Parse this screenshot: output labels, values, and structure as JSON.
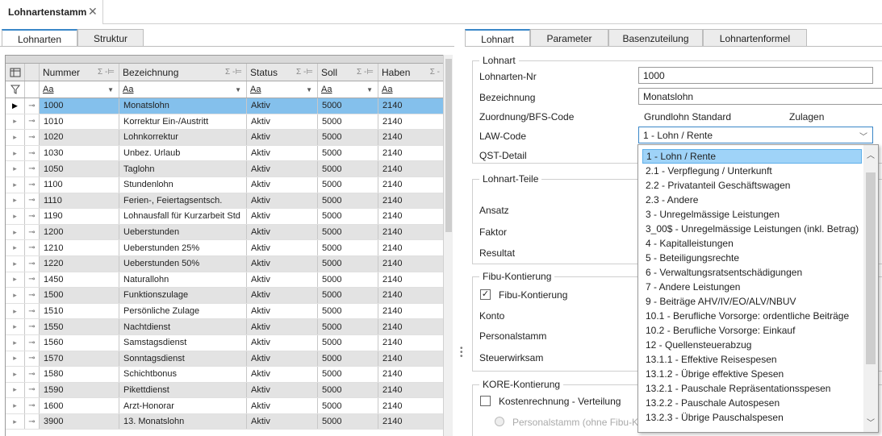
{
  "doc_tab": {
    "title": "Lohnartenstamm",
    "close": "✕"
  },
  "left_tabs": [
    {
      "label": "Lohnarten",
      "active": true
    },
    {
      "label": "Struktur",
      "active": false
    }
  ],
  "right_tabs": [
    {
      "label": "Lohnart",
      "active": true
    },
    {
      "label": "Parameter",
      "active": false
    },
    {
      "label": "Basenzuteilung",
      "active": false
    },
    {
      "label": "Lohnartenformel",
      "active": false
    }
  ],
  "grid": {
    "columns": [
      "Nummer",
      "Bezeichnung",
      "Status",
      "Soll",
      "Haben"
    ],
    "filter_text": "Aa",
    "selected_index": 0,
    "rows": [
      [
        "1000",
        "Monatslohn",
        "Aktiv",
        "5000",
        "2140"
      ],
      [
        "1010",
        "Korrektur Ein-/Austritt",
        "Aktiv",
        "5000",
        "2140"
      ],
      [
        "1020",
        "Lohnkorrektur",
        "Aktiv",
        "5000",
        "2140"
      ],
      [
        "1030",
        "Unbez. Urlaub",
        "Aktiv",
        "5000",
        "2140"
      ],
      [
        "1050",
        "Taglohn",
        "Aktiv",
        "5000",
        "2140"
      ],
      [
        "1100",
        "Stundenlohn",
        "Aktiv",
        "5000",
        "2140"
      ],
      [
        "1110",
        "Ferien-, Feiertagsentsch.",
        "Aktiv",
        "5000",
        "2140"
      ],
      [
        "1190",
        "Lohnausfall für Kurzarbeit Std",
        "Aktiv",
        "5000",
        "2140"
      ],
      [
        "1200",
        "Ueberstunden",
        "Aktiv",
        "5000",
        "2140"
      ],
      [
        "1210",
        "Ueberstunden 25%",
        "Aktiv",
        "5000",
        "2140"
      ],
      [
        "1220",
        "Ueberstunden 50%",
        "Aktiv",
        "5000",
        "2140"
      ],
      [
        "1450",
        "Naturallohn",
        "Aktiv",
        "5000",
        "2140"
      ],
      [
        "1500",
        "Funktionszulage",
        "Aktiv",
        "5000",
        "2140"
      ],
      [
        "1510",
        "Persönliche Zulage",
        "Aktiv",
        "5000",
        "2140"
      ],
      [
        "1550",
        "Nachtdienst",
        "Aktiv",
        "5000",
        "2140"
      ],
      [
        "1560",
        "Samstagsdienst",
        "Aktiv",
        "5000",
        "2140"
      ],
      [
        "1570",
        "Sonntagsdienst",
        "Aktiv",
        "5000",
        "2140"
      ],
      [
        "1580",
        "Schichtbonus",
        "Aktiv",
        "5000",
        "2140"
      ],
      [
        "1590",
        "Pikettdienst",
        "Aktiv",
        "5000",
        "2140"
      ],
      [
        "1600",
        "Arzt-Honorar",
        "Aktiv",
        "5000",
        "2140"
      ],
      [
        "3900",
        "13. Monatslohn",
        "Aktiv",
        "5000",
        "2140"
      ]
    ]
  },
  "form": {
    "group_lohnart": "Lohnart",
    "nr_label": "Lohnarten-Nr",
    "nr_value": "1000",
    "bez_label": "Bezeichnung",
    "bez_value": "Monatslohn",
    "zuord_label": "Zuordnung/BFS-Code",
    "zuord_value": "Grundlohn Standard",
    "zuord_value2": "Zulagen",
    "law_label": "LAW-Code",
    "law_value": "1 - Lohn / Rente",
    "qst_label": "QST-Detail",
    "group_teile": "Lohnart-Teile",
    "ansatz_label": "Ansatz",
    "faktor_label": "Faktor",
    "resultat_label": "Resultat",
    "group_fibu": "Fibu-Kontierung",
    "fibu_cb_label": "Fibu-Kontierung",
    "fibu_checked": true,
    "konto_label": "Konto",
    "personal_label": "Personalstamm",
    "steuer_label": "Steuerwirksam",
    "group_kore": "KORE-Kontierung",
    "kore_cb_label": "Kostenrechnung - Verteilung",
    "kore_checked": false,
    "radio_label": "Personalstamm (ohne Fibu-Ko"
  },
  "dropdown": {
    "selected_index": 0,
    "options": [
      "1 - Lohn / Rente",
      "2.1 - Verpflegung / Unterkunft",
      "2.2 - Privatanteil Geschäftswagen",
      "2.3 - Andere",
      "3 - Unregelmässige Leistungen",
      "3_00$ - Unregelmässige Leistungen (inkl. Betrag)",
      "4 - Kapitalleistungen",
      "5 - Beteiligungsrechte",
      "6 - Verwaltungsratsentschädigungen",
      "7 - Andere Leistungen",
      "9 - Beiträge AHV/IV/EO/ALV/NBUV",
      "10.1 - Berufliche Vorsorge: ordentliche Beiträge",
      "10.2 - Berufliche Vorsorge: Einkauf",
      "12 - Quellensteuerabzug",
      "13.1.1 - Effektive Reisespesen",
      "13.1.2 - Übrige effektive Spesen",
      "13.2.1 - Pauschale Repräsentationsspesen",
      "13.2.2 - Pauschale Autospesen",
      "13.2.3 - Übrige Pauschalspesen"
    ]
  },
  "colors": {
    "accent": "#3a87c8",
    "row_selected": "#84c0ec",
    "option_selected": "#9fd3f8",
    "row_alt": "#e3e3e3"
  }
}
